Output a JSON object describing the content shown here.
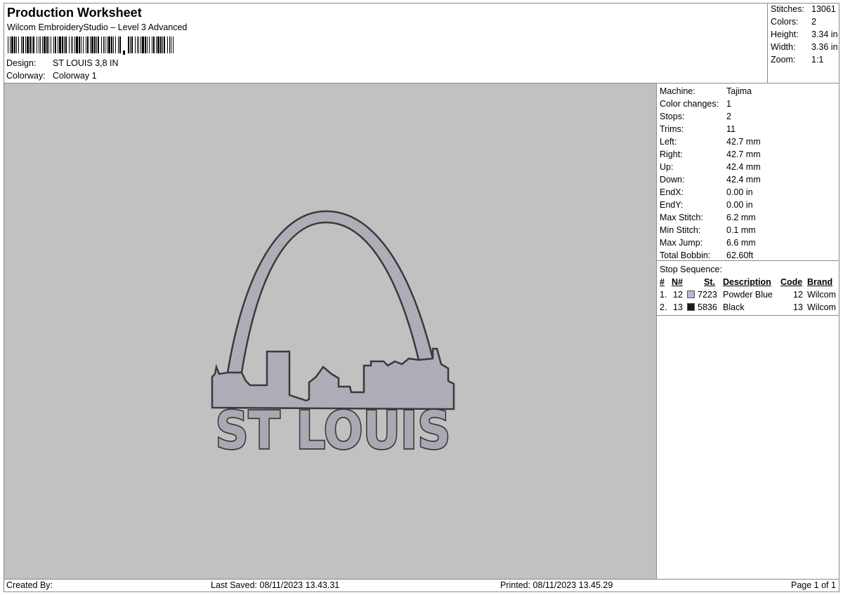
{
  "header": {
    "title": "Production Worksheet",
    "subtitle": "Wilcom EmbroideryStudio – Level 3 Advanced",
    "design_label": "Design:",
    "design_value": "ST LOUIS 3,8 IN",
    "colorway_label": "Colorway:",
    "colorway_value": "Colorway 1"
  },
  "summary": [
    {
      "label": "Stitches:",
      "value": "13061"
    },
    {
      "label": "Colors:",
      "value": "2"
    },
    {
      "label": "Height:",
      "value": "3.34 in"
    },
    {
      "label": "Width:",
      "value": "3.36 in"
    },
    {
      "label": "Zoom:",
      "value": "1:1"
    }
  ],
  "design": {
    "text": "ST LOUIS",
    "fill_color": "#a9a9b4",
    "outline_color": "#3a3a3a",
    "background": "#c1c1c1"
  },
  "info": [
    {
      "label": "Machine:",
      "value": "Tajima"
    },
    {
      "label": "Color changes:",
      "value": "1"
    },
    {
      "label": "Stops:",
      "value": "2"
    },
    {
      "label": "Trims:",
      "value": "11"
    },
    {
      "label": "Left:",
      "value": "42.7 mm"
    },
    {
      "label": "Right:",
      "value": "42.7 mm"
    },
    {
      "label": "Up:",
      "value": "42.4 mm"
    },
    {
      "label": "Down:",
      "value": "42.4 mm"
    },
    {
      "label": "EndX:",
      "value": "0.00 in"
    },
    {
      "label": "EndY:",
      "value": "0.00 in"
    },
    {
      "label": "Max Stitch:",
      "value": "6.2 mm"
    },
    {
      "label": "Min Stitch:",
      "value": "0.1 mm"
    },
    {
      "label": "Max Jump:",
      "value": "6.6 mm"
    },
    {
      "label": "Total Bobbin:",
      "value": "62.60ft"
    }
  ],
  "stop_sequence": {
    "title": "Stop Sequence:",
    "headers": {
      "num": "#",
      "n": "N#",
      "st": "St.",
      "description": "Description",
      "code": "Code",
      "brand": "Brand"
    },
    "rows": [
      {
        "num": "1.",
        "n": "12",
        "color": "#b7b7d8",
        "st": "7223",
        "description": "Powder Blue",
        "code": "12",
        "brand": "Wilcom"
      },
      {
        "num": "2.",
        "n": "13",
        "color": "#1a1a1a",
        "st": "5836",
        "description": "Black",
        "code": "13",
        "brand": "Wilcom"
      }
    ]
  },
  "footer": {
    "created_by": "Created By:",
    "last_saved": "Last Saved: 08/11/2023 13.43.31",
    "printed": "Printed: 08/11/2023 13.45.29",
    "page": "Page 1 of 1"
  }
}
